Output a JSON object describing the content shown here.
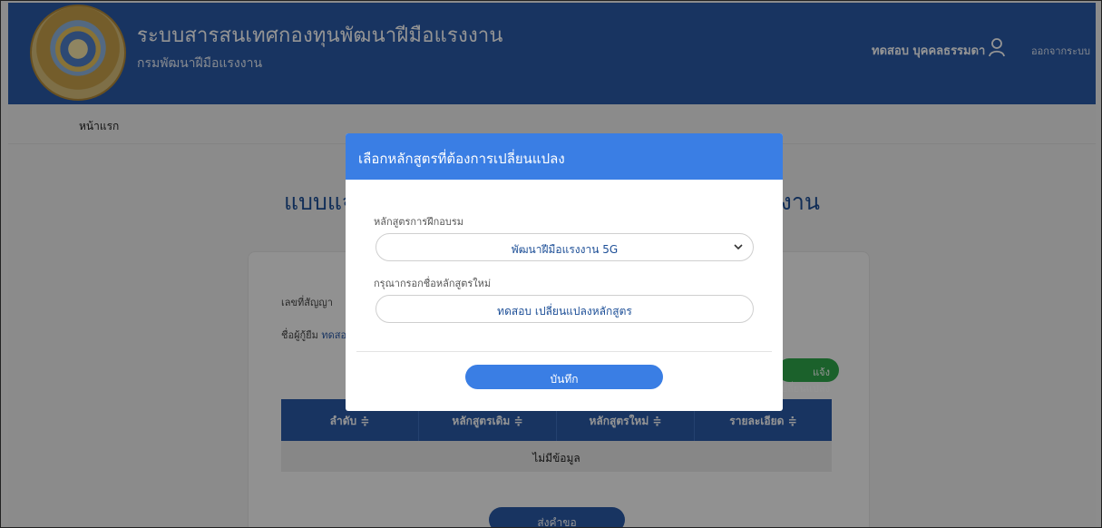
{
  "header": {
    "title": "ระบบสารสนเทศกองทุนพัฒนาฝีมือแรงงาน",
    "subtitle": "กรมพัฒนาฝีมือแรงงาน",
    "user_name": "ทดสอบ บุคคลธรรมดา",
    "logout_label": "ออกจากระบบ",
    "user_icon": "user-icon",
    "logo": "department-seal"
  },
  "breadcrumb": {
    "home": "หน้าแรก"
  },
  "form": {
    "title": "แบบแจ้งเปลี่ยนแปลงหลักสูตรกองทุนพัฒนาฝีมือแรงงาน",
    "contract_label": "เลขที่สัญญา",
    "borrower_label": "ชื่อผู้กู้ยืม",
    "borrower_value": "ทดสอบ บุคคลธรรมดา",
    "change_button": "แจ้งเปลี่ยนแปลง",
    "submit_button": "ส่งคำขอ",
    "table": {
      "columns": [
        "ลำดับ ≑",
        "หลักสูตรเดิม ≑",
        "หลักสูตรใหม่ ≑",
        "รายละเอียด ≑"
      ],
      "empty_text": "ไม่มีข้อมูล"
    }
  },
  "modal": {
    "title": "เลือกหลักสูตรที่ต้องการเปลี่ยนแปลง",
    "course_label": "หลักสูตรการฝึกอบรม",
    "course_selected": "พัฒนาฝีมือแรงงาน 5G",
    "new_course_label": "กรุณากรอกชื่อหลักสูตรใหม่",
    "new_course_value": "ทดสอบ เปลี่ยนแปลงหลักสูตร",
    "save_button": "บันทึก"
  },
  "colors": {
    "header": "#2a5aa8",
    "modal_header": "#3a7ee4",
    "green": "#2fa84a"
  }
}
